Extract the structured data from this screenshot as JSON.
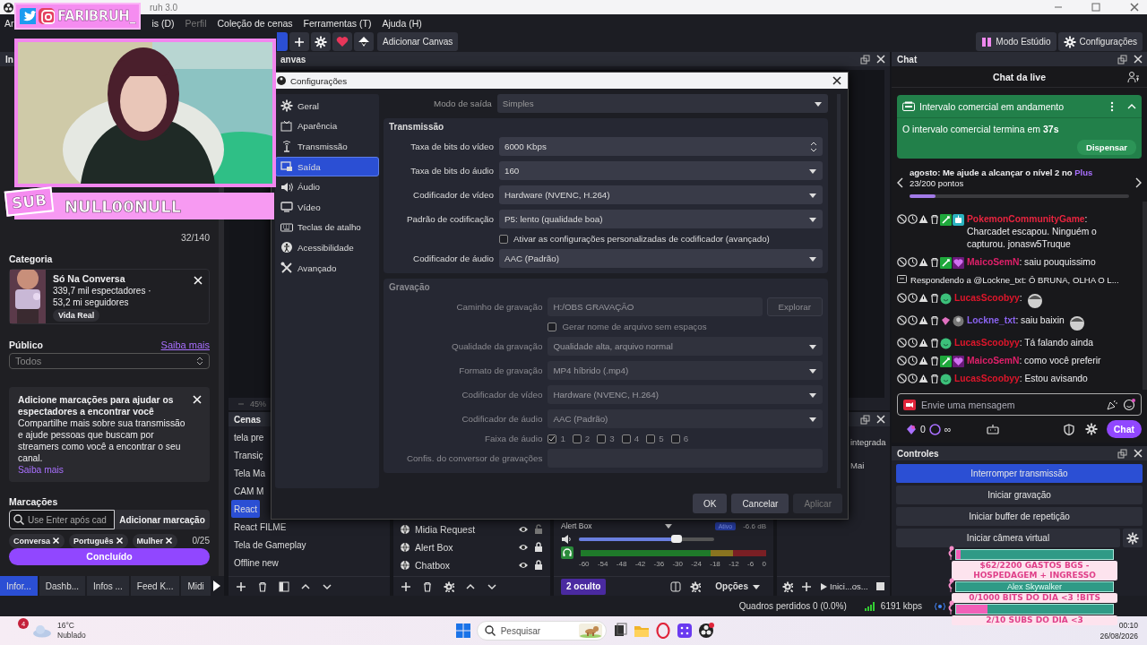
{
  "window": {
    "title": "ruh 3.0"
  },
  "menu": [
    {
      "label": "Ar",
      "disabled": false
    },
    {
      "label": "is (D)",
      "disabled": false
    },
    {
      "label": "Perfil",
      "disabled": true
    },
    {
      "label": "Coleção de cenas",
      "disabled": false
    },
    {
      "label": "Ferramentas (T)",
      "disabled": false
    },
    {
      "label": "Ajuda (H)",
      "disabled": false
    }
  ],
  "toolbar": {
    "add_canvas": "Adicionar Canvas",
    "studio_mode": "Modo Estúdio",
    "settings": "Configurações"
  },
  "stream_info": {
    "dock_title": "In",
    "title_count": "32/140",
    "category_heading": "Categoria",
    "category": {
      "name": "Só Na Conversa",
      "viewers": "339,7 mil espectadores ·",
      "followers": "53,2 mi seguidores",
      "tag": "Vida Real"
    },
    "audience": {
      "label": "Público",
      "link": "Saiba mais",
      "value": "Todos"
    },
    "notice": {
      "title": "Adicione marcações para ajudar os espectadores a encontrar você",
      "body": "Compartilhe mais sobre sua transmissão e ajude pessoas que buscam por streamers como você a encontrar o seu canal.",
      "link": "Saiba mais"
    },
    "tags": {
      "label": "Marcações",
      "placeholder": "Use Enter após cad",
      "add": "Adicionar marcação",
      "items": [
        "Conversa",
        "Português",
        "Mulher"
      ],
      "count": "0/25"
    },
    "done": "Concluído",
    "tabs": [
      {
        "label": "Infor...",
        "selected": true
      },
      {
        "label": "Dashb...",
        "selected": false
      },
      {
        "label": "Infos ...",
        "selected": false
      },
      {
        "label": "Feed K...",
        "selected": false
      },
      {
        "label": "Midi",
        "selected": false
      }
    ]
  },
  "canvas": {
    "title": "anvas",
    "zoom": "45%"
  },
  "scenes": {
    "title": "Cenas",
    "items": [
      {
        "label": "tela pre",
        "selected": false
      },
      {
        "label": "Transiç",
        "selected": false
      },
      {
        "label": "Tela Ma",
        "selected": false
      },
      {
        "label": "CAM M",
        "selected": false
      },
      {
        "label": "React",
        "selected": true
      },
      {
        "label": "React FILME",
        "selected": false
      },
      {
        "label": "Tela de Gameplay",
        "selected": false
      },
      {
        "label": "Offline new",
        "selected": false
      }
    ]
  },
  "sources": {
    "items": [
      {
        "label": "Midia Request",
        "visible": true,
        "locked": false
      },
      {
        "label": "Alert Box",
        "visible": true,
        "locked": true
      },
      {
        "label": "Chatbox",
        "visible": true,
        "locked": true
      }
    ]
  },
  "mixer": {
    "channel": "Alert Box",
    "status": "Ativo",
    "reading": "-6.6 dB",
    "level": 0.72,
    "ticks": [
      "-60",
      "-54",
      "-48",
      "-42",
      "-36",
      "-30",
      "-24",
      "-18",
      "-12",
      "-6",
      "0"
    ],
    "hidden_badge": "2 oculto",
    "options": "Opções"
  },
  "transitions": {
    "texts": [
      "integrada",
      "Mai"
    ],
    "action": "Inici...os..."
  },
  "chat": {
    "title": "Chat",
    "heading": "Chat da live",
    "ad": {
      "title": "Intervalo comercial em andamento",
      "body": "O intervalo comercial termina em **37s**",
      "dismiss": "Dispensar"
    },
    "goal": {
      "text": "agosto: Me ajude a alcançar o nível 2 no ",
      "highlight": "Plus",
      "progress": "23/200 pontos",
      "level": 0.12
    },
    "messages": [
      {
        "kind": "message",
        "user": "PokemonCommunityGame",
        "color": "#e8243f",
        "text": ": Charcadet escapou. Ninguém o capturou. jonasw5Truque"
      },
      {
        "kind": "message",
        "user": "MaicoSemN",
        "color": "#e0206a",
        "text": ": saiu pouquissimo"
      },
      {
        "kind": "reply",
        "text": "Respondendo a @Lockne_txt: Ô BRUNA, OLHA O L..."
      },
      {
        "kind": "message",
        "user": "LucasScoobyy",
        "color": "#e0162b",
        "text": ":",
        "emote": true
      },
      {
        "kind": "message",
        "user": "Lockne_txt",
        "color": "#8a63f0",
        "text": ": saiu baixin",
        "emote": true
      },
      {
        "kind": "message",
        "user": "LucasScoobyy",
        "color": "#e0162b",
        "text": ": Tá falando ainda"
      },
      {
        "kind": "message",
        "user": "MaicoSemN",
        "color": "#e0206a",
        "text": ": como você preferir"
      },
      {
        "kind": "message",
        "user": "LucasScoobyy",
        "color": "#e0162b",
        "text": ": Estou avisando"
      }
    ],
    "input_placeholder": "Envie uma mensagem",
    "points": "0",
    "infinity": "∞",
    "send": "Chat"
  },
  "controls": {
    "title": "Controles",
    "buttons": [
      {
        "label": "Interromper transmissão",
        "active": true
      },
      {
        "label": "Iniciar gravação",
        "active": false
      },
      {
        "label": "Iniciar buffer de repetição",
        "active": false
      },
      {
        "label": "Iniciar câmera virtual",
        "active": false
      }
    ]
  },
  "status_bar": {
    "dropped": "Quadros perdidos 0 (0.0%)",
    "bitrate": "6191 kbps"
  },
  "settings_dialog": {
    "title": "Configurações",
    "nav": [
      {
        "label": "Geral",
        "selected": false
      },
      {
        "label": "Aparência",
        "selected": false
      },
      {
        "label": "Transmissão",
        "selected": false
      },
      {
        "label": "Saída",
        "selected": true
      },
      {
        "label": "Áudio",
        "selected": false
      },
      {
        "label": "Vídeo",
        "selected": false
      },
      {
        "label": "Teclas de atalho",
        "selected": false
      },
      {
        "label": "Acessibilidade",
        "selected": false
      },
      {
        "label": "Avançado",
        "selected": false
      }
    ],
    "output_mode": {
      "label": "Modo de saída",
      "value": "Simples"
    },
    "sections": [
      {
        "title": "Transmissão",
        "disabled": false,
        "rows": [
          {
            "kind": "spin",
            "label": "Taxa de bits do vídeo",
            "value": "6000 Kbps"
          },
          {
            "kind": "select",
            "label": "Taxa de bits do áudio",
            "value": "160"
          },
          {
            "kind": "select",
            "label": "Codificador de vídeo",
            "value": "Hardware (NVENC, H.264)"
          },
          {
            "kind": "select",
            "label": "Padrão de codificação",
            "value": "P5: lento (qualidade boa)"
          },
          {
            "kind": "checkbox",
            "label": "Ativar as configurações personalizadas de codificador (avançado)",
            "checked": false
          },
          {
            "kind": "select",
            "label": "Codificador de áudio",
            "value": "AAC (Padrão)"
          }
        ]
      },
      {
        "title": "Gravação",
        "disabled": true,
        "rows": [
          {
            "kind": "path",
            "label": "Caminho de gravação",
            "value": "H:/OBS GRAVAÇÃO",
            "button": "Explorar"
          },
          {
            "kind": "checkbox",
            "label": "Gerar nome de arquivo sem espaços",
            "checked": false
          },
          {
            "kind": "select",
            "label": "Qualidade da gravação",
            "value": "Qualidade alta, arquivo normal"
          },
          {
            "kind": "select",
            "label": "Formato de gravação",
            "value": "MP4 híbrido (.mp4)"
          },
          {
            "kind": "select",
            "label": "Codificador de vídeo",
            "value": "Hardware (NVENC, H.264)"
          },
          {
            "kind": "select",
            "label": "Codificador de áudio",
            "value": "AAC (Padrão)"
          },
          {
            "kind": "tracks",
            "label": "Faixa de áudio",
            "tracks": [
              {
                "label": "1",
                "checked": true
              },
              {
                "label": "2",
                "checked": false
              },
              {
                "label": "3",
                "checked": false
              },
              {
                "label": "4",
                "checked": false
              },
              {
                "label": "5",
                "checked": false
              },
              {
                "label": "6",
                "checked": false
              }
            ]
          },
          {
            "kind": "text",
            "label": "Confis. do conversor de gravações"
          }
        ]
      }
    ],
    "buttons": [
      {
        "label": "OK",
        "disabled": false
      },
      {
        "label": "Cancelar",
        "disabled": false
      },
      {
        "label": "Aplicar",
        "disabled": true
      }
    ]
  },
  "cam_overlay": {
    "handle": "FARIBRUH_",
    "sub_label": "SUB",
    "sub_name": "NULL00NULL"
  },
  "goals_overlay": [
    {
      "text": "$62/2200 GASTOS BGS - HOSPEDAGEM + INGRESSO",
      "level": 0.03
    },
    {
      "bar_label": "Alex Skywalker",
      "text": "0/1000 BITS DO DIA <3 !BITS"
    },
    {
      "text": "2/10 SUBS DO DIA <3",
      "level": 0.2
    }
  ],
  "taskbar": {
    "weather_badge": "4",
    "temperature": "16°C",
    "condition": "Nublado",
    "search_placeholder": "Pesquisar",
    "time": "00:10",
    "date": "26/08/2026"
  }
}
